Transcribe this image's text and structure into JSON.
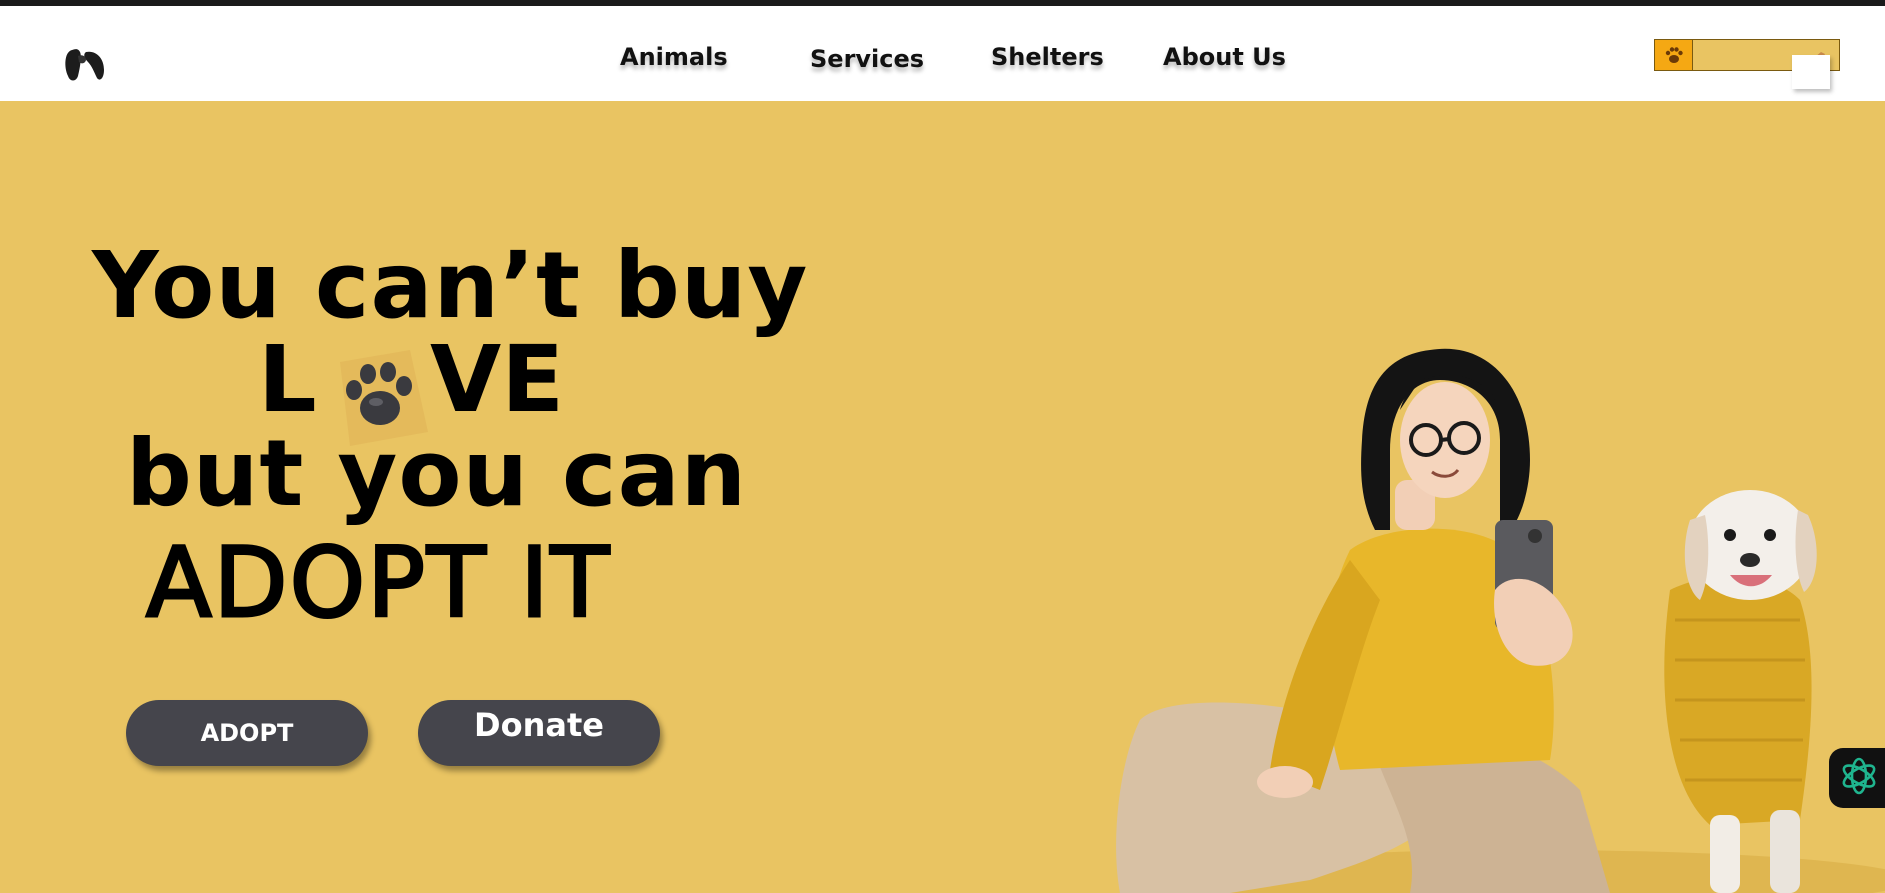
{
  "nav": {
    "logo_icon": "dog-ears-logo-icon",
    "links": [
      "Animals",
      "Services",
      "Shelters",
      "About Us"
    ],
    "cart_icon": "paw-icon",
    "cart_image": "running-dog-icon"
  },
  "hero": {
    "line1": "You can’t buy",
    "line2_start": "L",
    "line2_icon": "paw-print-icon",
    "line2_end": "VE",
    "line3": "but you can",
    "line4": "ADOPT  IT"
  },
  "buttons": {
    "adopt": "ADOPT",
    "donate": "Donate"
  },
  "illustration": "woman-with-phone-and-dog-illustration",
  "chat_icon": "ai-assistant-icon",
  "colors": {
    "background": "#e9c462",
    "navbar": "#ffffff",
    "button": "#45454c",
    "cart_paw": "#f5a813",
    "chat_icon": "#1fb58f"
  }
}
